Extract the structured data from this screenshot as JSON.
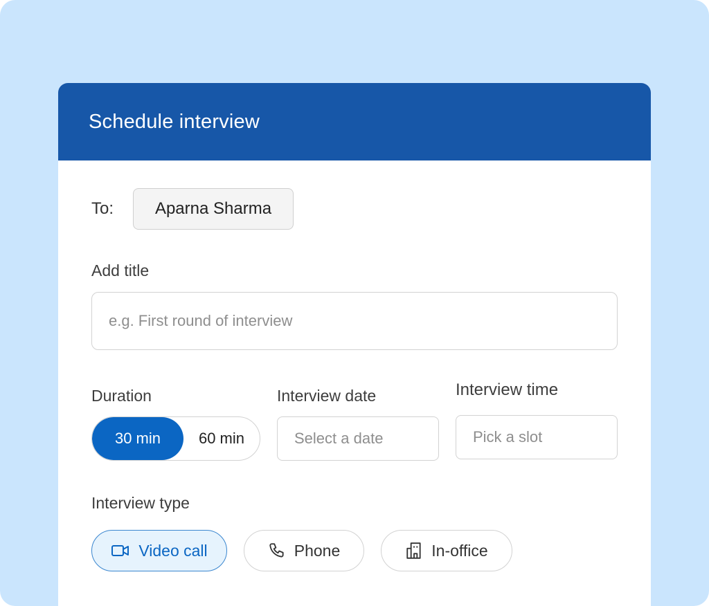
{
  "dialog": {
    "title": "Schedule interview"
  },
  "recipient": {
    "label": "To:",
    "name": "Aparna Sharma"
  },
  "title_field": {
    "label": "Add title",
    "value": "",
    "placeholder": "e.g. First round of interview"
  },
  "duration": {
    "label": "Duration",
    "options": [
      "30 min",
      "60 min"
    ],
    "selected": "30 min"
  },
  "interview_date": {
    "label": "Interview date",
    "placeholder": "Select a date"
  },
  "interview_time": {
    "label": "Interview time",
    "placeholder": "Pick a slot"
  },
  "interview_type": {
    "label": "Interview type",
    "options": [
      {
        "label": "Video call",
        "icon": "video-camera-icon"
      },
      {
        "label": "Phone",
        "icon": "phone-icon"
      },
      {
        "label": "In-office",
        "icon": "office-building-icon"
      }
    ],
    "selected": "Video call"
  },
  "colors": {
    "background": "#cae5fd",
    "header": "#1757a8",
    "accent": "#0b66c3",
    "selected_chip_bg": "#e6f3fd"
  }
}
